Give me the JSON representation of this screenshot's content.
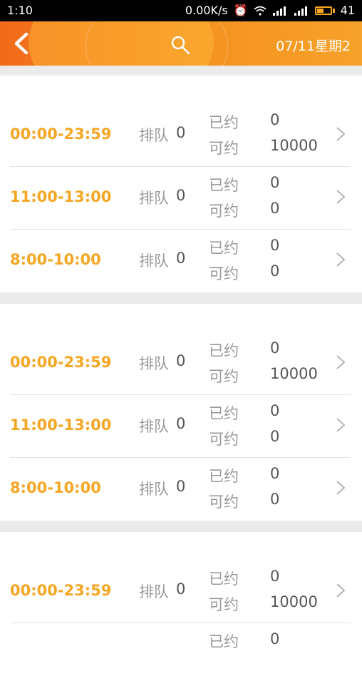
{
  "status_bar": {
    "time": "1:10",
    "net_speed": "0.00K/s",
    "battery": "41"
  },
  "header": {
    "date": "07/11星期2"
  },
  "sections": [
    {
      "title": "",
      "right": "",
      "rows": [
        {
          "time": "00:00-23:59",
          "queue_label": "排队",
          "queue": "0",
          "booked_label": "已约",
          "booked": "0",
          "avail_label": "可约",
          "avail": "10000"
        },
        {
          "time": "11:00-13:00",
          "queue_label": "排队",
          "queue": "0",
          "booked_label": "已约",
          "booked": "0",
          "avail_label": "可约",
          "avail": "0"
        },
        {
          "time": "8:00-10:00",
          "queue_label": "排队",
          "queue": "0",
          "booked_label": "已约",
          "booked": "0",
          "avail_label": "可约",
          "avail": "0"
        }
      ]
    },
    {
      "title": "",
      "right": "",
      "rows": [
        {
          "time": "00:00-23:59",
          "queue_label": "排队",
          "queue": "0",
          "booked_label": "已约",
          "booked": "0",
          "avail_label": "可约",
          "avail": "10000"
        },
        {
          "time": "11:00-13:00",
          "queue_label": "排队",
          "queue": "0",
          "booked_label": "已约",
          "booked": "0",
          "avail_label": "可约",
          "avail": "0"
        },
        {
          "time": "8:00-10:00",
          "queue_label": "排队",
          "queue": "0",
          "booked_label": "已约",
          "booked": "0",
          "avail_label": "可约",
          "avail": "0"
        }
      ]
    },
    {
      "title": "",
      "right": "",
      "rows": [
        {
          "time": "00:00-23:59",
          "queue_label": "排队",
          "queue": "0",
          "booked_label": "已约",
          "booked": "0",
          "avail_label": "可约",
          "avail": "10000"
        },
        {
          "time": "",
          "queue_label": "",
          "queue": "",
          "booked_label": "已约",
          "booked": "0",
          "avail_label": "",
          "avail": ""
        }
      ]
    }
  ],
  "colors": {
    "accent": "#f5a623",
    "header_start": "#f26a1a",
    "header_end": "#f7a22a"
  },
  "icons": {
    "back": "back-arrow-icon",
    "search": "search-icon",
    "chevron": "chevron-right-icon"
  }
}
